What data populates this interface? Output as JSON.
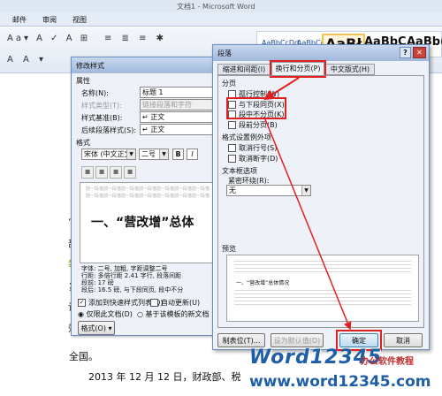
{
  "word": {
    "title": "文档1 - Microsoft Word",
    "tabs": [
      "邮件",
      "审阅",
      "视图"
    ],
    "styles": [
      "AaBbCcDd",
      "AaBbCcDd",
      "AaBł",
      "AaBbC",
      "AaBb("
    ],
    "doc_line1": "全国。",
    "doc_line2": "2013 年 12 月 12 日，财政部、税",
    "left_frag": [
      "“",
      "部",
      "等",
      "；",
      "设",
      "效"
    ]
  },
  "style_dialog": {
    "title": "修改样式",
    "section_props": "属性",
    "name_label": "名称(N):",
    "name_value": "标题 1",
    "type_label": "样式类型(T):",
    "type_value": "链接段落和字符",
    "base_label": "样式基准(B):",
    "base_value": "↵ 正文",
    "next_label": "后续段落样式(S):",
    "next_value": "↵ 正文",
    "section_format": "格式",
    "font_value": "宋体 (中文正文)",
    "size_value": "二号",
    "bold": "B",
    "italic": "I",
    "preview_gray": "前一段落前一段落前一段落前一段落前一段落前一段落前一段落前一段落前一段落前一段落前一段落前一段落前一段落前一段落",
    "preview_heading": "一、“营改增”总体",
    "desc": [
      "字体: 二号, 加粗, 字距调整二号",
      "行距: 多倍行距 2.41 字行, 段落间距",
      "段前: 17 磅",
      "段后: 16.5 磅, 与下段同页, 段中不分"
    ],
    "add_quick": "添加到快速样式列表(Q)",
    "auto_update": "自动更新(U)",
    "only_doc": "仅限此文档(D)",
    "new_doc": "基于该模板的新文档",
    "format_btn": "格式(O)"
  },
  "para_dialog": {
    "title": "段落",
    "help": "?",
    "close": "✕",
    "tabs": [
      "缩进和间距(I)",
      "换行和分页(P)",
      "中文版式(H)"
    ],
    "pagination_label": "分页",
    "widow": "孤行控制(W)",
    "keep_next": "与下段同页(X)",
    "keep_lines": "段中不分页(K)",
    "page_break": "段前分页(B)",
    "exceptions_label": "格式设置例外项",
    "suppress_num": "取消行号(S)",
    "no_hyphen": "取消断字(D)",
    "textbox_label": "文本框选项",
    "tight_wrap": "紧密环绕(R):",
    "tight_value": "无",
    "preview_label": "预览",
    "preview_text": "一、“营改增”总体情况",
    "tabs_btn": "制表位(T)...",
    "default_btn": "设为默认值(D)",
    "ok_btn": "确定",
    "cancel_btn": "取消"
  },
  "watermark": {
    "brand": "Word12345",
    "subtitle": "办公软件教程",
    "url": "www.word12345.com"
  },
  "colors": {
    "highlight": "#e02020",
    "dialog_border": "#6b8fc0",
    "titlebar": "#9fb8dc"
  }
}
